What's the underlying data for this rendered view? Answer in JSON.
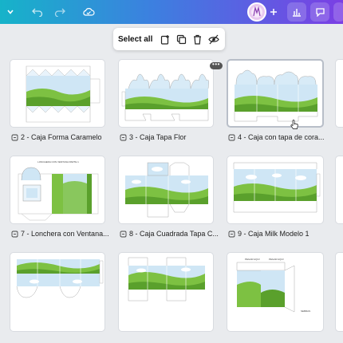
{
  "colors": {
    "accent_start": "#16b3c9",
    "accent_end": "#7b3fe4",
    "sky": "#cfe6f5",
    "grass": "#7dc142",
    "grass_dark": "#5aa02c"
  },
  "topbar": {
    "icons": [
      "chevron-down-icon",
      "undo-icon",
      "redo-icon",
      "cloud-sync-icon",
      "avatar",
      "plus-icon",
      "chart-icon",
      "comment-icon",
      "share-icon"
    ]
  },
  "toolbar": {
    "select_all_label": "Select all"
  },
  "pages": [
    {
      "label": "2 - Caja Forma Caramelo"
    },
    {
      "label": "3 - Caja Tapa Flor"
    },
    {
      "label": "4 - Caja con tapa de cora..."
    },
    {
      "label": "7 - Lonchera con Ventana..."
    },
    {
      "label": "8 - Caja Cuadrada Tapa C..."
    },
    {
      "label": "9 - Caja Milk Modelo 1"
    }
  ],
  "thumb_texts": {
    "lonchera_title": "LONCHERA CON VENTANA PARTE 1",
    "tiny_label": "PEGAR AQUI",
    "stamp_text": "SEBRAS"
  },
  "card_menu_label": "•••"
}
